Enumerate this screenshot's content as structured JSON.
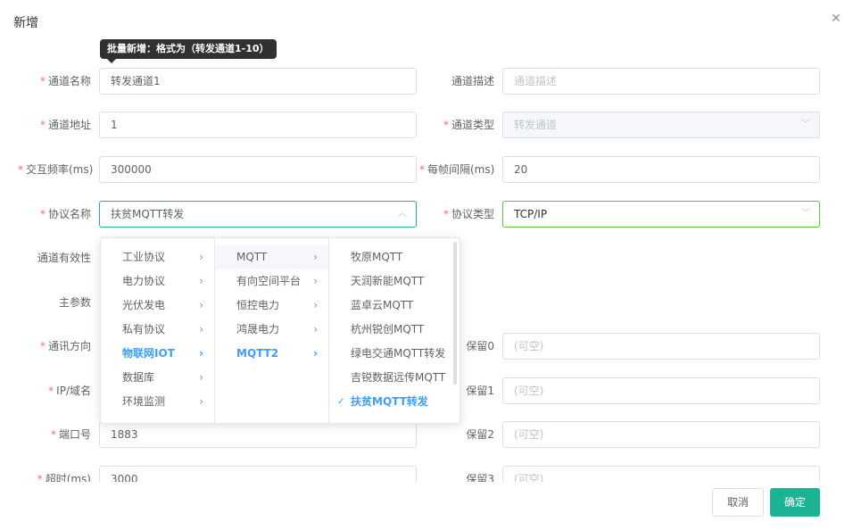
{
  "dialog": {
    "title": "新增",
    "close_icon": "close-icon",
    "tooltip": "批量新增：格式为（转发通道1-10）"
  },
  "form": {
    "required_mark": "*",
    "channel_name": {
      "label": "通道名称",
      "value": "转发通道1"
    },
    "channel_desc": {
      "label": "通道描述",
      "placeholder": "通道描述"
    },
    "channel_addr": {
      "label": "通道地址",
      "value": "1"
    },
    "channel_type": {
      "label": "通道类型",
      "value": "转发通道"
    },
    "interact_freq": {
      "label": "交互频率(ms)",
      "value": "300000"
    },
    "frame_interval": {
      "label": "每帧间隔(ms)",
      "value": "20"
    },
    "protocol_name": {
      "label": "协议名称",
      "value": "扶贫MQTT转发"
    },
    "protocol_type": {
      "label": "协议类型",
      "value": "TCP/IP"
    },
    "channel_valid": {
      "label": "通道有效性"
    },
    "main_param": {
      "label": "主参数"
    },
    "comm_dir": {
      "label": "通讯方向"
    },
    "ip_domain": {
      "label": "IP/域名"
    },
    "port": {
      "label": "端口号",
      "value": "1883"
    },
    "timeout": {
      "label": "超时(ms)",
      "value": "3000"
    },
    "reserve0": {
      "label": "保留0",
      "placeholder": "(可空)"
    },
    "reserve1": {
      "label": "保留1",
      "placeholder": "(可空)"
    },
    "reserve2": {
      "label": "保留2",
      "placeholder": "(可空)"
    },
    "reserve3": {
      "label": "保留3",
      "placeholder": "(可空)"
    }
  },
  "cascader": {
    "col1": [
      "工业协议",
      "电力协议",
      "光伏发电",
      "私有协议",
      "物联网IOT",
      "数据库",
      "环境监测"
    ],
    "col2": [
      "MQTT",
      "有向空间平台",
      "恒控电力",
      "鸿晟电力",
      "MQTT2"
    ],
    "col3": [
      "牧原MQTT",
      "天润新能MQTT",
      "蓝卓云MQTT",
      "杭州锐创MQTT",
      "绿电交通MQTT转发",
      "吉锐数据远传MQTT",
      "扶贫MQTT转发"
    ],
    "check_icon": "check-icon",
    "chevron_icon": "chevron-right-icon"
  },
  "buttons": {
    "cancel": "取消",
    "ok": "确定"
  },
  "colors": {
    "accent": "#1ab394",
    "active_blue": "#409eff",
    "required": "#f56c6c",
    "valid_green": "#67c23a"
  }
}
